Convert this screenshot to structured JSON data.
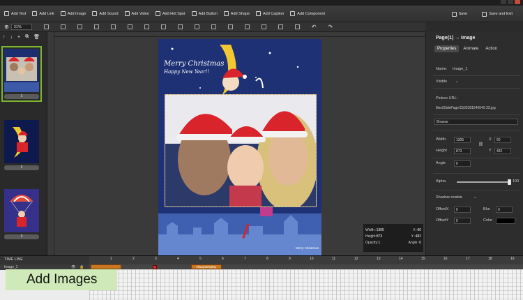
{
  "toolbar": {
    "items": [
      "Add Text",
      "Add Link",
      "Add Image",
      "Add Sound",
      "Add Video",
      "Add Hot Spot",
      "Add Button",
      "Add Shape",
      "Add Caption",
      "Add Component"
    ],
    "save": "Save",
    "save_exit": "Save and Exit"
  },
  "zoom": {
    "value": "31%"
  },
  "pages": {
    "thumbs": [
      "1",
      "2",
      "3"
    ]
  },
  "slide": {
    "title": "Merry Christmas",
    "subtitle": "Happy New Year!!",
    "footer": "Merry Christmas"
  },
  "info": {
    "width_label": "Width :",
    "width": "1305",
    "x_label": "X :",
    "x": "60",
    "height_label": "Height:",
    "height": "873",
    "y_label": "Y :",
    "y": "482",
    "opacity_label": "Opacity:",
    "opacity": "1",
    "angle_label": "Angle :",
    "angle": "0"
  },
  "props": {
    "title": "Page(1) → Image",
    "tabs": [
      "Properties",
      "Animate",
      "Action"
    ],
    "name_label": "Name:",
    "name_value": "Image_1",
    "visible_label": "Visible",
    "picture_url_label": "Picture URL:",
    "picture_url": "files/SlidePage/1503281646049 33.jpg",
    "browse": "Browse",
    "width_label": "Width",
    "width": "1305",
    "x_label": "X",
    "x": "60",
    "height_label": "Height",
    "height": "873",
    "y_label": "Y",
    "y": "482",
    "angle_label": "Angle",
    "angle": "0",
    "alpha_label": "Alpha",
    "alpha": "100",
    "shadow_label": "Shadow enable",
    "offsetx_label": "OffsetX",
    "offsetx": "0",
    "blur_label": "Blur",
    "blur": "0",
    "offsety_label": "OffsetY",
    "offsety": "0",
    "color_label": "Color"
  },
  "timeline": {
    "label": "TIME LINE",
    "layer": "Image_1",
    "ticks": [
      "1",
      "2",
      "3",
      "4",
      "5",
      "6",
      "7",
      "8",
      "9",
      "10",
      "11",
      "12",
      "13",
      "14",
      "15",
      "16",
      "17",
      "18",
      "19"
    ],
    "clip1": "",
    "clip2": "AlwaysDisplay"
  },
  "caption": "Add Images"
}
